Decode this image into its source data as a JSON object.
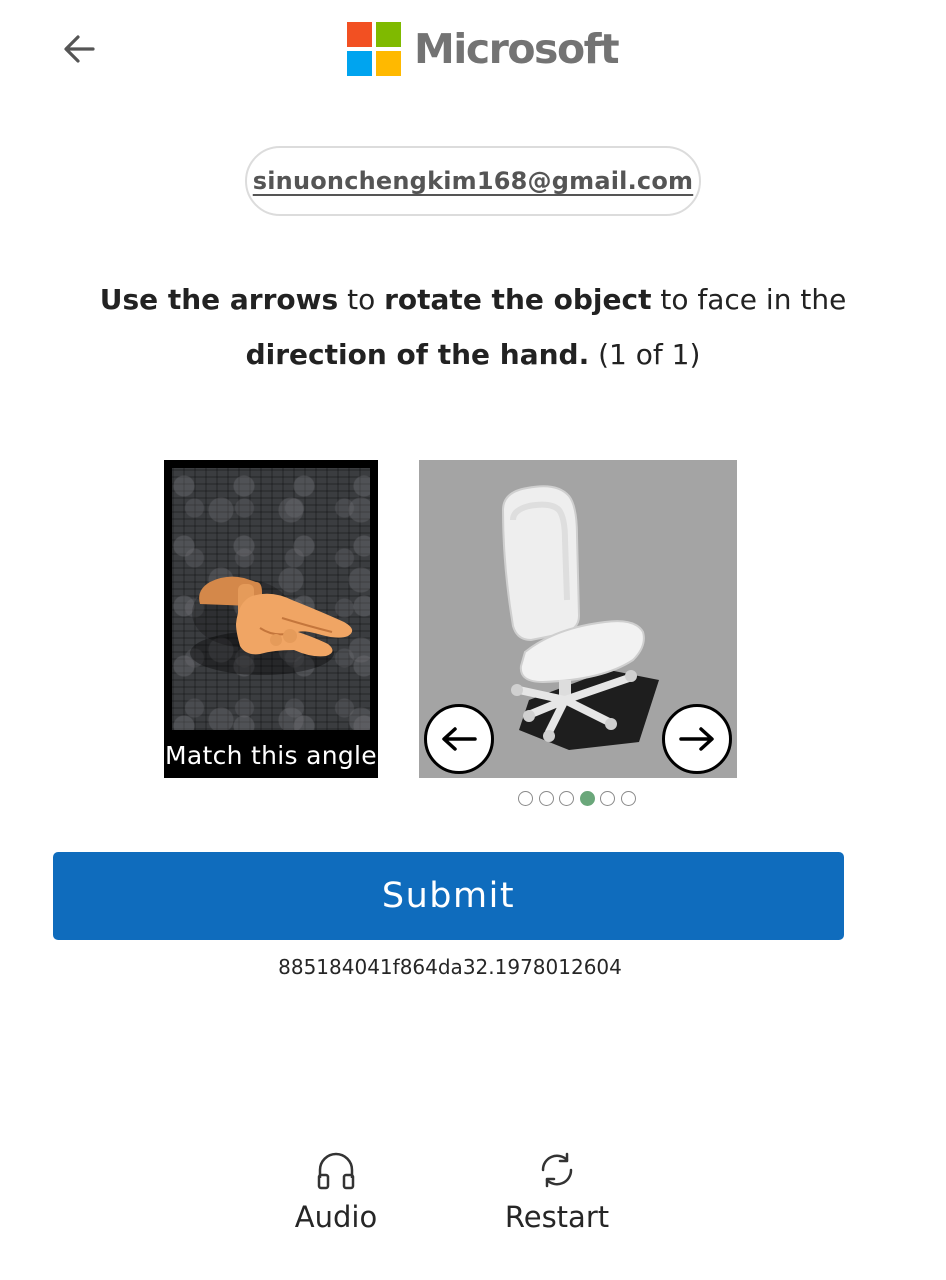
{
  "header": {
    "brand_name": "Microsoft",
    "logo_colors": [
      "#f25022",
      "#7fba00",
      "#00a4ef",
      "#ffb900"
    ]
  },
  "identity": {
    "email": "sinuonchengkim168@gmail.com"
  },
  "instruction": {
    "part1": "Use the arrows",
    "part2": " to ",
    "part3": "rotate the object",
    "part4": " to face in the ",
    "part5": "direction of the hand.",
    "part6": " (1 of 1)"
  },
  "challenge": {
    "reference_caption": "Match this angle",
    "prev_icon": "arrow-left-icon",
    "next_icon": "arrow-right-icon",
    "position_dots": {
      "count": 6,
      "active_index": 3
    }
  },
  "submit": {
    "label": "Submit"
  },
  "session_id": "885184041f864da32.1978012604",
  "footer": {
    "audio_label": "Audio",
    "audio_icon": "headphones-icon",
    "restart_label": "Restart",
    "restart_icon": "refresh-icon"
  },
  "colors": {
    "primary": "#0f6cbd",
    "active_dot": "#6aa77a"
  }
}
